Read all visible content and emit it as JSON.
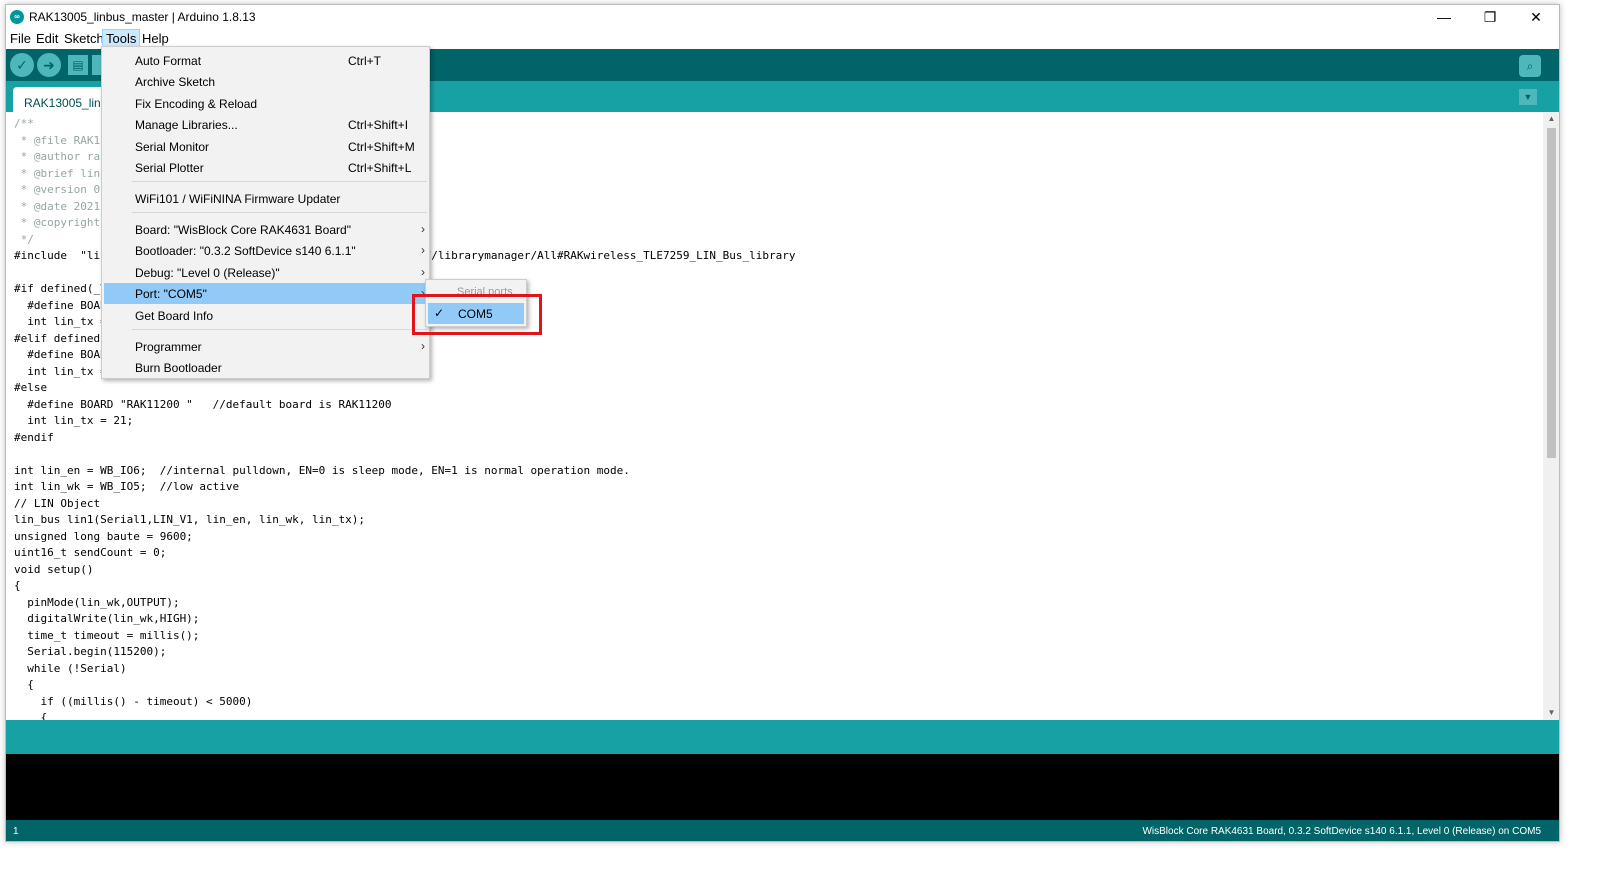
{
  "window": {
    "title": "RAK13005_linbus_master | Arduino 1.8.13",
    "app_icon": "arduino-logo-icon",
    "controls": {
      "minimize": "—",
      "restore": "❐",
      "close": "✕"
    }
  },
  "menubar": {
    "items": [
      "File",
      "Edit",
      "Sketch",
      "Tools",
      "Help"
    ],
    "active": "Tools"
  },
  "toolbar": {
    "buttons": [
      "verify-icon",
      "upload-icon",
      "new-icon",
      "open-icon",
      "save-icon"
    ],
    "serial_monitor": "serial-monitor-icon"
  },
  "tab": {
    "label": "RAK13005_linbus_master"
  },
  "editor": {
    "lines": [
      "/**",
      " * @file RAK13005_linbus_master.ino",
      " * @author rakwireless.com",
      " * @brief linbus master send data example",
      " * @version 0.1",
      " * @date 2021-05-01",
      " * @copyright Copyright (c) 2021",
      " */",
      "#include  \"lin_bus.h\"       // Click to install library: http://librarymanager/All#RAKwireless_TLE7259_LIN_Bus_library",
      "",
      "#if defined(_VARIANT_RAK4630_)",
      "  #define BOARD \"RAK4631 \"",
      "  int lin_tx = 16;",
      "#elif defined(_VARIANT_RAK11300_)",
      "  #define BOARD \"RAK11310 \"",
      "  int lin_tx = 0;",
      "#else",
      "  #define BOARD \"RAK11200 \"   //default board is RAK11200",
      "  int lin_tx = 21;",
      "#endif",
      "",
      "int lin_en = WB_IO6;  //internal pulldown, EN=0 is sleep mode, EN=1 is normal operation mode.",
      "int lin_wk = WB_IO5;  //low active",
      "// LIN Object",
      "lin_bus lin1(Serial1,LIN_V1, lin_en, lin_wk, lin_tx);",
      "unsigned long baute = 9600;",
      "uint16_t sendCount = 0;",
      "void setup()",
      "{",
      "  pinMode(lin_wk,OUTPUT);",
      "  digitalWrite(lin_wk,HIGH);",
      "  time_t timeout = millis();",
      "  Serial.begin(115200);",
      "  while (!Serial)",
      "  {",
      "    if ((millis() - timeout) < 5000)",
      "    {"
    ]
  },
  "tools_menu": {
    "items": [
      {
        "label": "Auto Format",
        "shortcut": "Ctrl+T"
      },
      {
        "label": "Archive Sketch",
        "shortcut": ""
      },
      {
        "label": "Fix Encoding & Reload",
        "shortcut": ""
      },
      {
        "label": "Manage Libraries...",
        "shortcut": "Ctrl+Shift+I"
      },
      {
        "label": "Serial Monitor",
        "shortcut": "Ctrl+Shift+M"
      },
      {
        "label": "Serial Plotter",
        "shortcut": "Ctrl+Shift+L"
      },
      {
        "label": "WiFi101 / WiFiNINA Firmware Updater",
        "shortcut": ""
      },
      {
        "label": "Board: \"WisBlock Core RAK4631 Board\"",
        "shortcut": ""
      },
      {
        "label": "Bootloader: \"0.3.2 SoftDevice s140 6.1.1\"",
        "shortcut": ""
      },
      {
        "label": "Debug: \"Level 0 (Release)\"",
        "shortcut": ""
      },
      {
        "label": "Port: \"COM5\"",
        "shortcut": ""
      },
      {
        "label": "Get Board Info",
        "shortcut": ""
      },
      {
        "label": "Programmer",
        "shortcut": ""
      },
      {
        "label": "Burn Bootloader",
        "shortcut": ""
      }
    ],
    "submenu_arrow": "›",
    "highlighted": "Port: \"COM5\""
  },
  "port_submenu": {
    "header": "Serial ports",
    "item": "COM5",
    "checked": true,
    "check_glyph": "✓"
  },
  "annotation": {
    "color": "#e3131a"
  },
  "footer": {
    "line_number": "1",
    "board_info": "WisBlock Core RAK4631 Board, 0.3.2 SoftDevice s140 6.1.1, Level 0 (Release) on COM5"
  },
  "colors": {
    "toolbar": "#006468",
    "tabbar": "#17a1a5",
    "menu_highlight": "#91c9f7"
  }
}
